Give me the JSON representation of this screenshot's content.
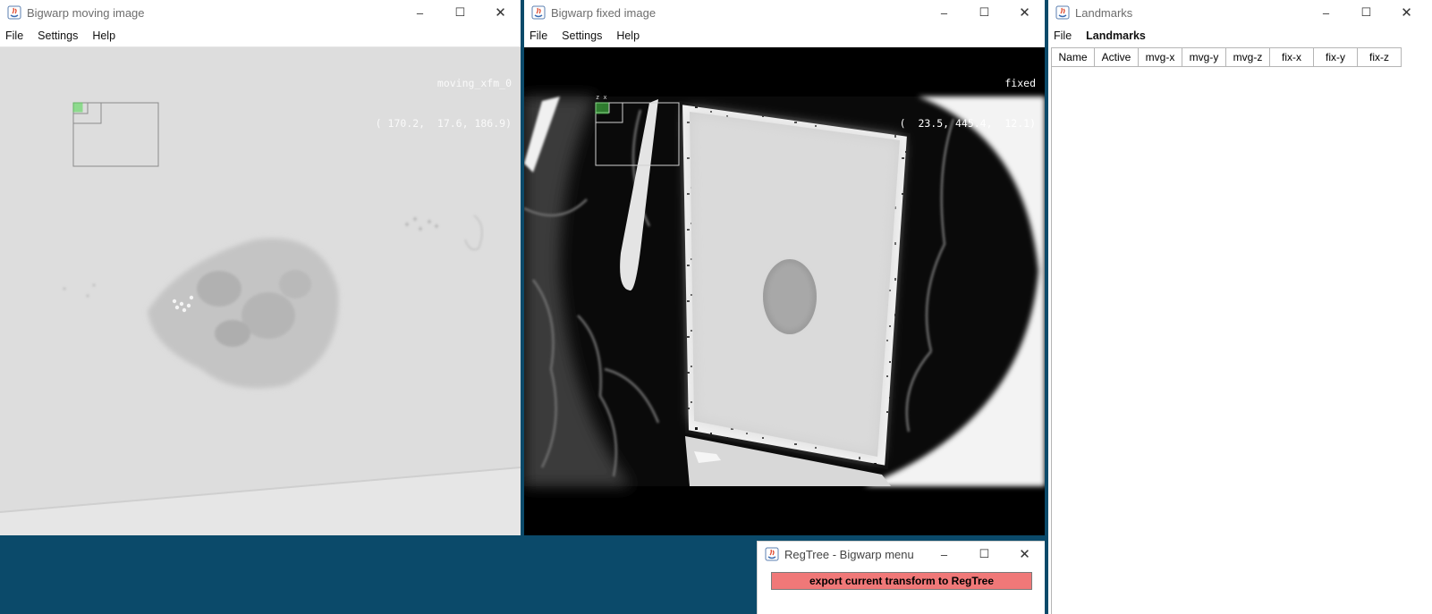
{
  "moving": {
    "title": "Bigwarp moving image",
    "menus": [
      "File",
      "Settings",
      "Help"
    ],
    "overlay_name": "moving_xfm_0",
    "overlay_coords": "( 170.2,  17.6, 186.9)"
  },
  "fixed": {
    "title": "Bigwarp fixed image",
    "menus": [
      "File",
      "Settings",
      "Help"
    ],
    "overlay_name": "fixed",
    "overlay_coords": "(  23.5, 445.4,  12.1)"
  },
  "landmarks": {
    "title": "Landmarks",
    "menus": [
      "File",
      "Landmarks"
    ],
    "columns": [
      "Name",
      "Active",
      "mvg-x",
      "mvg-y",
      "mvg-z",
      "fix-x",
      "fix-y",
      "fix-z"
    ]
  },
  "regtree": {
    "title": "RegTree - Bigwarp menu",
    "export_label": "export current transform to RegTree"
  },
  "controls": {
    "minimize": "–",
    "maximize": "☐",
    "close": "✕"
  },
  "axis_label": "z x",
  "colors": {
    "desktop": "#0b4a6a",
    "export_button": "#f07878",
    "bounding_box_highlight": "#4cd84c"
  },
  "icons": [
    "java-app-icon",
    "minimize-icon",
    "maximize-icon",
    "close-icon"
  ]
}
